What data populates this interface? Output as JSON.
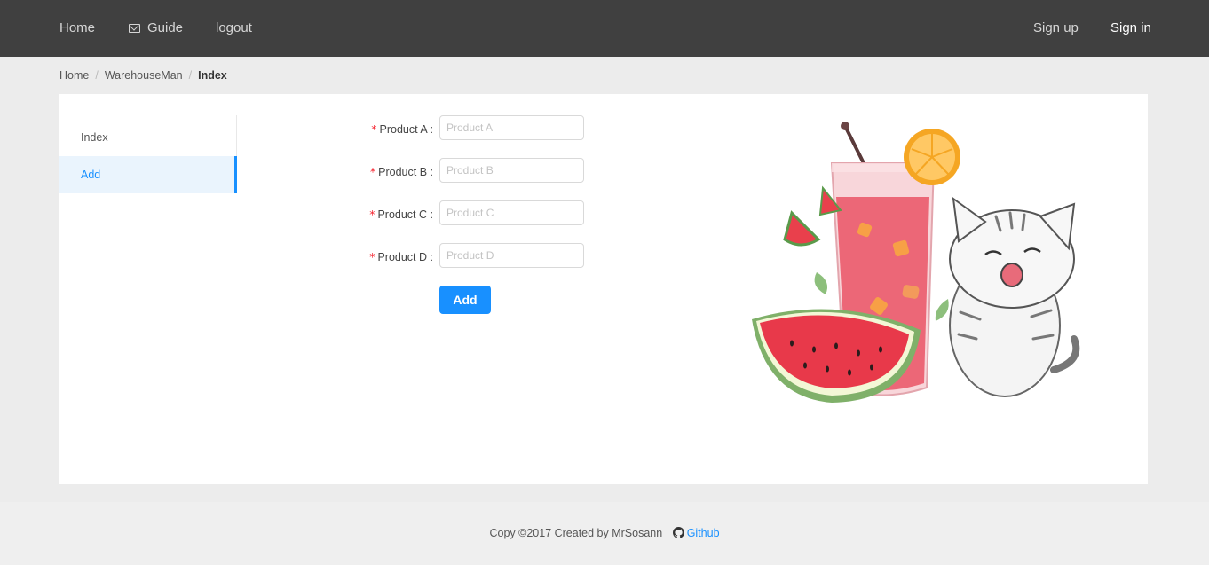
{
  "nav": {
    "home": "Home",
    "guide": "Guide",
    "logout": "logout",
    "signup": "Sign up",
    "signin": "Sign in"
  },
  "breadcrumb": [
    "Home",
    "WarehouseMan",
    "Index"
  ],
  "menu": {
    "items": [
      {
        "label": "Index",
        "active": false
      },
      {
        "label": "Add",
        "active": true
      }
    ]
  },
  "form": {
    "fields": [
      {
        "label": "Product A",
        "placeholder": "Product A",
        "value": ""
      },
      {
        "label": "Product B",
        "placeholder": "Product B",
        "value": ""
      },
      {
        "label": "Product C",
        "placeholder": "Product C",
        "value": ""
      },
      {
        "label": "Product D",
        "placeholder": "Product D",
        "value": ""
      }
    ],
    "required_mark": "*",
    "label_suffix": ":",
    "submit_label": "Add"
  },
  "footer": {
    "copyright": "Copy ©2017 Created by MrSosann",
    "github_label": "Github"
  },
  "colors": {
    "topbar": "#404040",
    "accent": "#1890ff",
    "required": "#f5222d"
  }
}
